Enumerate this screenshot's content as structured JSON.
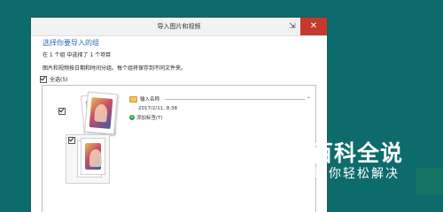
{
  "window": {
    "title": "导入图片和视频",
    "close_glyph": "✕"
  },
  "content": {
    "heading": "选择你要导入的组",
    "summary": "在 1 个组 中选择了 1 个项目",
    "description": "图片和视频按日期和时间分组。每个组将保存到不同文件夹。",
    "select_all_label": "全选(5)"
  },
  "group": {
    "name": "输入名称",
    "datetime": "2017/2/11, 8:38",
    "add_tags_label": "添加标签(T)"
  },
  "watermark": {
    "title": "百科全说",
    "subtitle": "助你轻松解决"
  },
  "colors": {
    "background": "#0e6b6b",
    "heading": "#2a6fb4",
    "close_button": "#c7392d"
  }
}
